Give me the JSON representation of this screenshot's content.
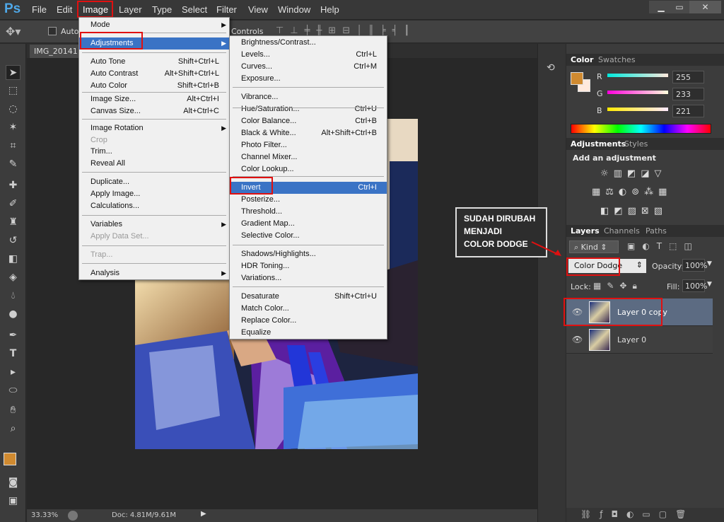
{
  "app": {
    "logo": "Ps"
  },
  "menubar": [
    "File",
    "Edit",
    "Image",
    "Layer",
    "Type",
    "Select",
    "Filter",
    "View",
    "Window",
    "Help"
  ],
  "window_controls": {
    "minimize": "▁",
    "restore": "▭",
    "close": "✕"
  },
  "options_bar": {
    "auto_select_label": "Auto-",
    "controls_label": "Controls"
  },
  "document": {
    "tab_title": "IMG_20141",
    "zoom": "33.33%",
    "doc_info": "Doc: 4.81M/9.61M"
  },
  "image_menu": {
    "items": [
      {
        "label": "Mode",
        "shortcut": "",
        "submenu": true
      },
      {
        "label": "Adjustments",
        "shortcut": "",
        "submenu": true,
        "highlight": true
      },
      {
        "label": "Auto Tone",
        "shortcut": "Shift+Ctrl+L"
      },
      {
        "label": "Auto Contrast",
        "shortcut": "Alt+Shift+Ctrl+L"
      },
      {
        "label": "Auto Color",
        "shortcut": "Shift+Ctrl+B"
      },
      {
        "label": "Image Size...",
        "shortcut": "Alt+Ctrl+I"
      },
      {
        "label": "Canvas Size...",
        "shortcut": "Alt+Ctrl+C"
      },
      {
        "label": "Image Rotation",
        "shortcut": "",
        "submenu": true
      },
      {
        "label": "Crop",
        "shortcut": "",
        "disabled": true
      },
      {
        "label": "Trim...",
        "shortcut": ""
      },
      {
        "label": "Reveal All",
        "shortcut": ""
      },
      {
        "label": "Duplicate...",
        "shortcut": ""
      },
      {
        "label": "Apply Image...",
        "shortcut": ""
      },
      {
        "label": "Calculations...",
        "shortcut": ""
      },
      {
        "label": "Variables",
        "shortcut": "",
        "submenu": true
      },
      {
        "label": "Apply Data Set...",
        "shortcut": "",
        "disabled": true
      },
      {
        "label": "Trap...",
        "shortcut": "",
        "disabled": true
      },
      {
        "label": "Analysis",
        "shortcut": "",
        "submenu": true
      }
    ]
  },
  "adjustments_menu": {
    "items": [
      {
        "label": "Brightness/Contrast...",
        "shortcut": ""
      },
      {
        "label": "Levels...",
        "shortcut": "Ctrl+L"
      },
      {
        "label": "Curves...",
        "shortcut": "Ctrl+M"
      },
      {
        "label": "Exposure...",
        "shortcut": ""
      },
      {
        "label": "Vibrance...",
        "shortcut": ""
      },
      {
        "label": "Hue/Saturation...",
        "shortcut": "Ctrl+U"
      },
      {
        "label": "Color Balance...",
        "shortcut": "Ctrl+B"
      },
      {
        "label": "Black & White...",
        "shortcut": "Alt+Shift+Ctrl+B"
      },
      {
        "label": "Photo Filter...",
        "shortcut": ""
      },
      {
        "label": "Channel Mixer...",
        "shortcut": ""
      },
      {
        "label": "Color Lookup...",
        "shortcut": ""
      },
      {
        "label": "Invert",
        "shortcut": "Ctrl+I",
        "highlight": true
      },
      {
        "label": "Posterize...",
        "shortcut": ""
      },
      {
        "label": "Threshold...",
        "shortcut": ""
      },
      {
        "label": "Gradient Map...",
        "shortcut": ""
      },
      {
        "label": "Selective Color...",
        "shortcut": ""
      },
      {
        "label": "Shadows/Highlights...",
        "shortcut": ""
      },
      {
        "label": "HDR Toning...",
        "shortcut": ""
      },
      {
        "label": "Variations...",
        "shortcut": ""
      },
      {
        "label": "Desaturate",
        "shortcut": "Shift+Ctrl+U"
      },
      {
        "label": "Match Color...",
        "shortcut": ""
      },
      {
        "label": "Replace Color...",
        "shortcut": ""
      },
      {
        "label": "Equalize",
        "shortcut": ""
      }
    ]
  },
  "color_panel": {
    "tabs": [
      "Color",
      "Swatches"
    ],
    "r_label": "R",
    "g_label": "G",
    "b_label": "B",
    "r": "255",
    "g": "233",
    "b": "221",
    "foreground": "#d08a30",
    "background": "#ffe9dd"
  },
  "adjustments_panel": {
    "tabs": [
      "Adjustments",
      "Styles"
    ],
    "heading": "Add an adjustment"
  },
  "layers_panel": {
    "tabs": [
      "Layers",
      "Channels",
      "Paths"
    ],
    "kind_label": "Kind",
    "blend_mode": "Color Dodge",
    "opacity_label": "Opacity:",
    "opacity": "100%",
    "lock_label": "Lock:",
    "fill_label": "Fill:",
    "fill": "100%",
    "layers": [
      {
        "name": "Layer 0 copy",
        "selected": true
      },
      {
        "name": "Layer 0",
        "selected": false
      }
    ]
  },
  "annotation": {
    "lines": [
      "SUDAH DIRUBAH",
      "MENJADI",
      "COLOR DODGE"
    ]
  },
  "icons": {
    "move": "move-tool-icon",
    "marquee": "marquee-icon"
  }
}
